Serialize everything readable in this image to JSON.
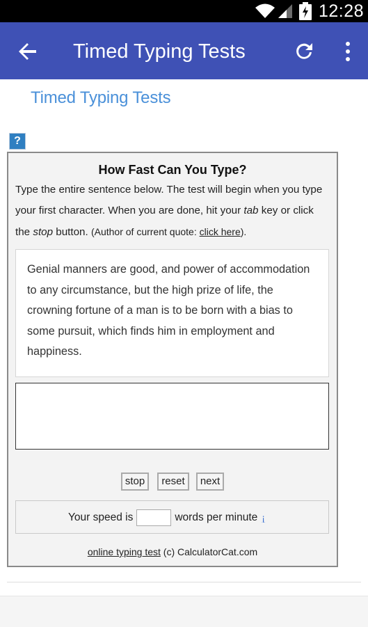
{
  "status_bar": {
    "time": "12:28"
  },
  "app_bar": {
    "title": "Timed Typing Tests",
    "back_icon": "arrow-back-icon",
    "refresh_icon": "refresh-icon",
    "more_icon": "more-vert-icon",
    "color": "#3f51b5"
  },
  "page": {
    "heading": "Timed Typing Tests",
    "help_icon_text": "?",
    "panel": {
      "title": "How Fast Can You Type?",
      "instructions": {
        "part1": "Type the entire sentence below. The test will begin when you type your first character. When you are done, hit your ",
        "tab_word": "tab",
        "part2": " key or click the ",
        "stop_word": "stop",
        "part3": " button. ",
        "author_prefix": "(Author of current quote: ",
        "author_link": "click here",
        "author_suffix": ")."
      },
      "quote": "Genial manners are good, and power of accommodation to any circumstance, but the high prize of life, the crowning fortune of a man is to be born with a bias to some pursuit, which finds him in employment and happiness.",
      "typing_value": "",
      "buttons": {
        "stop": "stop",
        "reset": "reset",
        "next": "next"
      },
      "speed": {
        "prefix": "Your speed is",
        "value": "",
        "suffix": "words per minute",
        "help": "¡"
      },
      "footer": {
        "link": "online typing test",
        "rest": " (c) CalculatorCat.com"
      }
    }
  }
}
